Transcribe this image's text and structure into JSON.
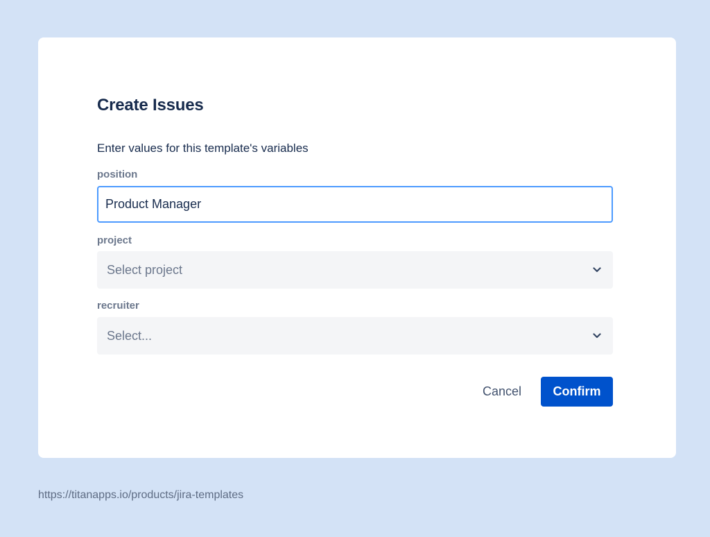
{
  "dialog": {
    "title": "Create Issues",
    "subtitle": "Enter values for this template's variables",
    "fields": {
      "position": {
        "label": "position",
        "value": "Product Manager"
      },
      "project": {
        "label": "project",
        "placeholder": "Select project"
      },
      "recruiter": {
        "label": "recruiter",
        "placeholder": "Select..."
      }
    },
    "actions": {
      "cancel_label": "Cancel",
      "confirm_label": "Confirm"
    },
    "icons": {
      "dropdown": "chevron-down-icon"
    },
    "colors": {
      "background": "#d3e2f6",
      "primary": "#0052cc",
      "focus_border": "#4c9aff",
      "text": "#172b4d",
      "label": "#6b778c"
    }
  },
  "footer": {
    "url": "https://titanapps.io/products/jira-templates"
  }
}
